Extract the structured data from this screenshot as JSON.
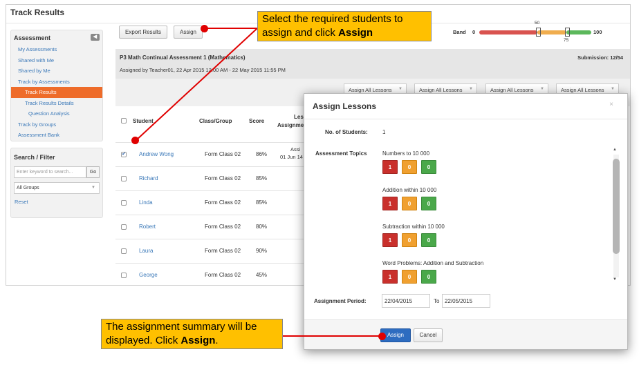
{
  "page": {
    "title": "Track Results"
  },
  "sidebar": {
    "heading": "Assessment",
    "collapse_icon": "◀",
    "items": [
      {
        "label": "My Assessments",
        "level": 1,
        "active": false
      },
      {
        "label": "Shared with Me",
        "level": 1,
        "active": false
      },
      {
        "label": "Shared by Me",
        "level": 1,
        "active": false
      },
      {
        "label": "Track by Assessments",
        "level": 1,
        "active": false
      },
      {
        "label": "Track Results",
        "level": 2,
        "active": true
      },
      {
        "label": "Track Results Details",
        "level": 2,
        "active": false
      },
      {
        "label": "Question Analysis",
        "level": 3,
        "active": false
      },
      {
        "label": "Track by Groups",
        "level": 1,
        "active": false
      },
      {
        "label": "Assessment Bank",
        "level": 1,
        "active": false
      }
    ],
    "search": {
      "heading": "Search / Filter",
      "placeholder": "Enter keyword to search...",
      "go_label": "Go",
      "group_select": "All Groups",
      "reset_label": "Reset"
    }
  },
  "toolbar": {
    "export_label": "Export Results",
    "assign_label": "Assign"
  },
  "band": {
    "label": "Band",
    "min": "0",
    "max": "100",
    "mark_low": "50",
    "mark_high": "75",
    "low_value": 50,
    "high_value": 75,
    "colors": {
      "red": "#d9534f",
      "orange": "#f0ad4e",
      "green": "#5cb85c"
    }
  },
  "assessment": {
    "title": "P3 Math Continual Assessment 1 (Mathematics)",
    "subtitle": "Assigned by Teacher01, 22 Apr 2015 12:00 AM - 22 May 2015 11:55 PM",
    "submission": "Submission: 12/54",
    "assign_all_label": "Assign All Lessons"
  },
  "table": {
    "headers": {
      "student": "Student",
      "class": "Class/Group",
      "score": "Score",
      "lesson": "Less",
      "assignment": "Assignme"
    },
    "rows": [
      {
        "checked": true,
        "name": "Andrew Wong",
        "class": "Form Class 02",
        "score": "86%",
        "assign1": "Assi",
        "assign2": "01 Jun 14 -"
      },
      {
        "checked": false,
        "name": "Richard",
        "class": "Form Class 02",
        "score": "85%",
        "dash": "-"
      },
      {
        "checked": false,
        "name": "Linda",
        "class": "Form Class 02",
        "score": "85%",
        "dash": "-"
      },
      {
        "checked": false,
        "name": "Robert",
        "class": "Form Class 02",
        "score": "80%",
        "dash": "-"
      },
      {
        "checked": false,
        "name": "Laura",
        "class": "Form Class 02",
        "score": "90%",
        "dash": "-"
      },
      {
        "checked": false,
        "name": "George",
        "class": "Form Class 02",
        "score": "45%",
        "dash": "-"
      }
    ]
  },
  "modal": {
    "title": "Assign Lessons",
    "close_icon": "×",
    "students_label": "No. of Students:",
    "students_value": "1",
    "topics_label": "Assessment Topics",
    "topics": [
      {
        "name": "Numbers to 10 000",
        "bands": [
          "1",
          "0",
          "0"
        ]
      },
      {
        "name": "Addition within 10 000",
        "bands": [
          "1",
          "0",
          "0"
        ]
      },
      {
        "name": "Subtraction within 10 000",
        "bands": [
          "1",
          "0",
          "0"
        ]
      },
      {
        "name": "Word Problems: Addition and Subtraction",
        "bands": [
          "1",
          "0",
          "0"
        ]
      }
    ],
    "period_label": "Assignment Period:",
    "from_date": "22/04/2015",
    "to_label": "To",
    "to_date": "22/05/2015",
    "assign_label": "Assign",
    "cancel_label": "Cancel"
  },
  "callouts": {
    "top_text": "Select the required students to assign and click ",
    "top_bold": "Assign",
    "bottom_text": "The assignment summary will be displayed. Click ",
    "bottom_bold": "Assign",
    "bottom_end": "."
  }
}
